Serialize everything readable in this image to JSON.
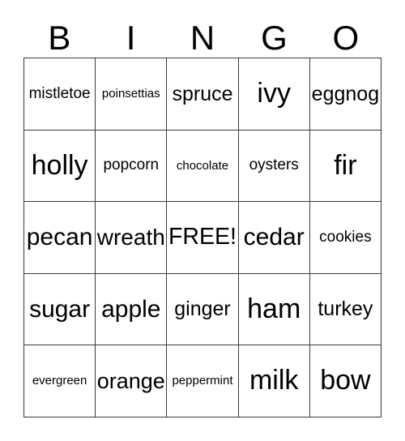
{
  "card": {
    "title": "BINGO Card",
    "header_letters": [
      "B",
      "I",
      "N",
      "G",
      "O"
    ],
    "free_space_label": "FREE!",
    "colors": {
      "background": "#ffffff",
      "text": "#000000",
      "grid_line": "#3a3a3a"
    },
    "grid": {
      "columns": 5,
      "rows": 5,
      "cells": [
        [
          {
            "label": "mistletoe",
            "size": "sm"
          },
          {
            "label": "poinsettias",
            "size": "xs"
          },
          {
            "label": "spruce",
            "size": "md"
          },
          {
            "label": "ivy",
            "size": "xl"
          },
          {
            "label": "eggnog",
            "size": "md"
          }
        ],
        [
          {
            "label": "holly",
            "size": "xl"
          },
          {
            "label": "popcorn",
            "size": "sm"
          },
          {
            "label": "chocolate",
            "size": "xs"
          },
          {
            "label": "oysters",
            "size": "sm"
          },
          {
            "label": "fir",
            "size": "xl"
          }
        ],
        [
          {
            "label": "pecan",
            "size": "lg"
          },
          {
            "label": "wreath",
            "size": "lg"
          },
          {
            "label": "FREE!",
            "size": "lg"
          },
          {
            "label": "cedar",
            "size": "lg"
          },
          {
            "label": "cookies",
            "size": "sm"
          }
        ],
        [
          {
            "label": "sugar",
            "size": "lg"
          },
          {
            "label": "apple",
            "size": "lg"
          },
          {
            "label": "ginger",
            "size": "md"
          },
          {
            "label": "ham",
            "size": "xl"
          },
          {
            "label": "turkey",
            "size": "md"
          }
        ],
        [
          {
            "label": "evergreen",
            "size": "xs"
          },
          {
            "label": "orange",
            "size": "lg"
          },
          {
            "label": "peppermint",
            "size": "xs"
          },
          {
            "label": "milk",
            "size": "xl"
          },
          {
            "label": "bow",
            "size": "xl"
          }
        ]
      ]
    }
  }
}
